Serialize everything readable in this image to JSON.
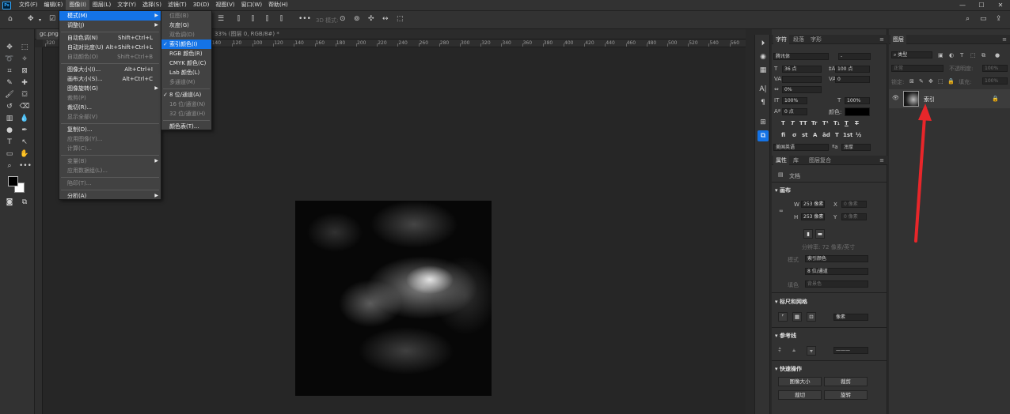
{
  "menubar": {
    "logo": "Ps",
    "items": [
      "文件(F)",
      "编辑(E)",
      "图像(I)",
      "图层(L)",
      "文字(Y)",
      "选择(S)",
      "滤镜(T)",
      "3D(D)",
      "视图(V)",
      "窗口(W)",
      "帮助(H)"
    ],
    "active_index": 2,
    "window_controls": [
      "—",
      "☐",
      "✕"
    ]
  },
  "options_bar": {
    "label_3d": "3D 模式:"
  },
  "document": {
    "tab1": "gc.png @",
    "tab2": "33% (图层 0, RGB/8#) *",
    "ruler_labels": [
      "320",
      "280",
      "260",
      "240",
      "220",
      "200",
      "180",
      "160",
      "140",
      "120",
      "100",
      "120",
      "140",
      "160",
      "180",
      "200",
      "220",
      "240",
      "260",
      "280",
      "300",
      "320",
      "340",
      "360",
      "380",
      "400",
      "420",
      "440",
      "460",
      "480",
      "500",
      "520",
      "540",
      "560"
    ]
  },
  "image_menu": {
    "items": [
      {
        "label": "模式(M)",
        "shortcut": "",
        "submenu": true,
        "disabled": false,
        "highlighted": true
      },
      {
        "label": "调整(J)",
        "shortcut": "",
        "submenu": true,
        "disabled": false,
        "highlighted": false
      },
      {
        "label": "自动色调(N)",
        "shortcut": "Shift+Ctrl+L",
        "submenu": false,
        "disabled": false,
        "highlighted": false
      },
      {
        "label": "自动对比度(U)",
        "shortcut": "Alt+Shift+Ctrl+L",
        "submenu": false,
        "disabled": false,
        "highlighted": false
      },
      {
        "label": "自动颜色(O)",
        "shortcut": "Shift+Ctrl+B",
        "submenu": false,
        "disabled": true,
        "highlighted": false
      },
      {
        "label": "图像大小(I)...",
        "shortcut": "Alt+Ctrl+I",
        "submenu": false,
        "disabled": false,
        "highlighted": false
      },
      {
        "label": "画布大小(S)...",
        "shortcut": "Alt+Ctrl+C",
        "submenu": false,
        "disabled": false,
        "highlighted": false
      },
      {
        "label": "图像旋转(G)",
        "shortcut": "",
        "submenu": true,
        "disabled": false,
        "highlighted": false
      },
      {
        "label": "裁剪(P)",
        "shortcut": "",
        "submenu": false,
        "disabled": true,
        "highlighted": false
      },
      {
        "label": "裁切(R)...",
        "shortcut": "",
        "submenu": false,
        "disabled": false,
        "highlighted": false
      },
      {
        "label": "显示全部(V)",
        "shortcut": "",
        "submenu": false,
        "disabled": true,
        "highlighted": false
      },
      {
        "label": "复制(D)...",
        "shortcut": "",
        "submenu": false,
        "disabled": false,
        "highlighted": false
      },
      {
        "label": "应用图像(Y)...",
        "shortcut": "",
        "submenu": false,
        "disabled": true,
        "highlighted": false
      },
      {
        "label": "计算(C)...",
        "shortcut": "",
        "submenu": false,
        "disabled": true,
        "highlighted": false
      },
      {
        "label": "变量(B)",
        "shortcut": "",
        "submenu": true,
        "disabled": true,
        "highlighted": false
      },
      {
        "label": "应用数据组(L)...",
        "shortcut": "",
        "submenu": false,
        "disabled": true,
        "highlighted": false
      },
      {
        "label": "陷印(T)...",
        "shortcut": "",
        "submenu": false,
        "disabled": true,
        "highlighted": false
      },
      {
        "label": "分析(A)",
        "shortcut": "",
        "submenu": true,
        "disabled": false,
        "highlighted": false
      }
    ]
  },
  "mode_submenu": {
    "items": [
      {
        "label": "位图(B)",
        "disabled": true,
        "checked": false,
        "highlighted": false
      },
      {
        "label": "灰度(G)",
        "disabled": false,
        "checked": false,
        "highlighted": false
      },
      {
        "label": "双色调(D)",
        "disabled": true,
        "checked": false,
        "highlighted": false
      },
      {
        "label": "索引颜色(I)",
        "disabled": false,
        "checked": true,
        "highlighted": true
      },
      {
        "label": "RGB 颜色(R)",
        "disabled": false,
        "checked": false,
        "highlighted": false
      },
      {
        "label": "CMYK 颜色(C)",
        "disabled": false,
        "checked": false,
        "highlighted": false
      },
      {
        "label": "Lab 颜色(L)",
        "disabled": false,
        "checked": false,
        "highlighted": false
      },
      {
        "label": "多通道(M)",
        "disabled": true,
        "checked": false,
        "highlighted": false
      },
      {
        "label": "8 位/通道(A)",
        "disabled": false,
        "checked": true,
        "highlighted": false
      },
      {
        "label": "16 位/通道(N)",
        "disabled": true,
        "checked": false,
        "highlighted": false
      },
      {
        "label": "32 位/通道(H)",
        "disabled": true,
        "checked": false,
        "highlighted": false
      },
      {
        "label": "颜色表(T)...",
        "disabled": false,
        "checked": false,
        "highlighted": false
      }
    ]
  },
  "character_panel": {
    "tabs": [
      "字符",
      "段落",
      "字形"
    ],
    "font_family": "腾讯体",
    "font_style": "-",
    "font_size": "36 点",
    "leading": "100 点",
    "kerning": "",
    "tracking": "0",
    "scale_percent": "0%",
    "vertical_scale": "100%",
    "horizontal_scale": "100%",
    "baseline": "0 点",
    "color_label": "颜色:",
    "glyph_buttons": [
      "T",
      "T",
      "TT",
      "Tr",
      "T¹",
      "T₁",
      "T",
      "T"
    ],
    "glyph_buttons2": [
      "fi",
      "ơ",
      "st",
      "A",
      "ād",
      "T",
      "1st",
      "½"
    ],
    "language": "美国英语",
    "aa_label": "ªa",
    "aa_value": "浑厚"
  },
  "properties_panel": {
    "tabs": [
      "属性",
      "库",
      "图层复合"
    ],
    "doc_label": "文档",
    "canvas_section": "画布",
    "w_label": "W",
    "w_value": "253 像素",
    "x_label": "X",
    "x_value": "0 像素",
    "h_label": "H",
    "h_value": "253 像素",
    "y_label": "Y",
    "y_value": "0 像素",
    "resolution": "分辨率: 72 像素/英寸",
    "mode_label": "模式",
    "mode_value": "索引颜色",
    "bits_value": "8 位/通道",
    "fill_label": "填色",
    "fill_value": "背景色",
    "rulers_section": "标尺和网格",
    "units_value": "像素",
    "guides_section": "参考线",
    "quick_section": "快速操作",
    "quick_buttons": [
      "图像大小",
      "裁剪",
      "裁切",
      "旋转"
    ]
  },
  "layers_panel": {
    "tab": "图层",
    "kind_label": "类型",
    "blend_mode": "正常",
    "opacity_label": "不透明度:",
    "opacity_value": "100%",
    "lock_label": "锁定:",
    "fill_label": "填充:",
    "fill_value": "100%",
    "layer_name": "索引"
  },
  "annotation": {
    "arrow_color": "#e8262a"
  }
}
